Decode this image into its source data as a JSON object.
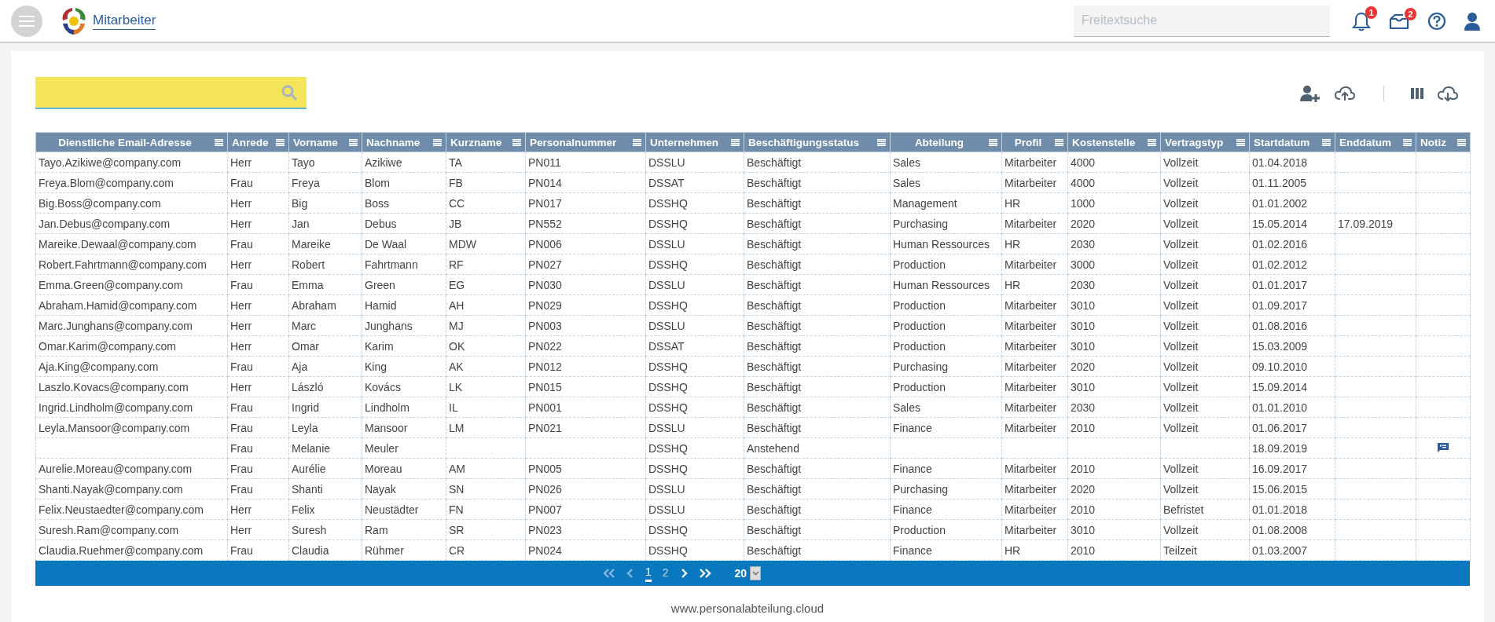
{
  "header": {
    "app_title": "Mitarbeiter",
    "search": {
      "placeholder": "Freitextsuche"
    },
    "notifications_badge": "1",
    "messages_badge": "2"
  },
  "table": {
    "columns": [
      {
        "label": "Dienstliche Email-Adresse"
      },
      {
        "label": "Anrede"
      },
      {
        "label": "Vorname"
      },
      {
        "label": "Nachname"
      },
      {
        "label": "Kurzname"
      },
      {
        "label": "Personalnummer"
      },
      {
        "label": "Unternehmen"
      },
      {
        "label": "Beschäftigungsstatus"
      },
      {
        "label": "Abteilung"
      },
      {
        "label": "Profil"
      },
      {
        "label": "Kostenstelle"
      },
      {
        "label": "Vertragstyp"
      },
      {
        "label": "Startdatum"
      },
      {
        "label": "Enddatum"
      },
      {
        "label": "Notiz"
      }
    ],
    "rows": [
      {
        "cells": [
          "Tayo.Azikiwe@company.com",
          "Herr",
          "Tayo",
          "Azikiwe",
          "TA",
          "PN011",
          "DSSLU",
          "Beschäftigt",
          "Sales",
          "Mitarbeiter",
          "4000",
          "Vollzeit",
          "01.04.2018",
          ""
        ],
        "has_note": false
      },
      {
        "cells": [
          "Freya.Blom@company.com",
          "Frau",
          "Freya",
          "Blom",
          "FB",
          "PN014",
          "DSSAT",
          "Beschäftigt",
          "Sales",
          "Mitarbeiter",
          "4000",
          "Vollzeit",
          "01.11.2005",
          ""
        ],
        "has_note": false
      },
      {
        "cells": [
          "Big.Boss@company.com",
          "Herr",
          "Big",
          "Boss",
          "CC",
          "PN017",
          "DSSHQ",
          "Beschäftigt",
          "Management",
          "HR",
          "1000",
          "Vollzeit",
          "01.01.2002",
          ""
        ],
        "has_note": false
      },
      {
        "cells": [
          "Jan.Debus@company.com",
          "Herr",
          "Jan",
          "Debus",
          "JB",
          "PN552",
          "DSSHQ",
          "Beschäftigt",
          "Purchasing",
          "Mitarbeiter",
          "2020",
          "Vollzeit",
          "15.05.2014",
          "17.09.2019"
        ],
        "has_note": false
      },
      {
        "cells": [
          "Mareike.Dewaal@company.com",
          "Frau",
          "Mareike",
          "De Waal",
          "MDW",
          "PN006",
          "DSSLU",
          "Beschäftigt",
          "Human Ressources",
          "HR",
          "2030",
          "Vollzeit",
          "01.02.2016",
          ""
        ],
        "has_note": false
      },
      {
        "cells": [
          "Robert.Fahrtmann@company.com",
          "Herr",
          "Robert",
          "Fahrtmann",
          "RF",
          "PN027",
          "DSSHQ",
          "Beschäftigt",
          "Production",
          "Mitarbeiter",
          "3000",
          "Vollzeit",
          "01.02.2012",
          ""
        ],
        "has_note": false
      },
      {
        "cells": [
          "Emma.Green@company.com",
          "Frau",
          "Emma",
          "Green",
          "EG",
          "PN030",
          "DSSLU",
          "Beschäftigt",
          "Human Ressources",
          "HR",
          "2030",
          "Vollzeit",
          "01.01.2017",
          ""
        ],
        "has_note": false
      },
      {
        "cells": [
          "Abraham.Hamid@company.com",
          "Herr",
          "Abraham",
          "Hamid",
          "AH",
          "PN029",
          "DSSHQ",
          "Beschäftigt",
          "Production",
          "Mitarbeiter",
          "3010",
          "Vollzeit",
          "01.09.2017",
          ""
        ],
        "has_note": false
      },
      {
        "cells": [
          "Marc.Junghans@company.com",
          "Herr",
          "Marc",
          "Junghans",
          "MJ",
          "PN003",
          "DSSLU",
          "Beschäftigt",
          "Production",
          "Mitarbeiter",
          "3010",
          "Vollzeit",
          "01.08.2016",
          ""
        ],
        "has_note": false
      },
      {
        "cells": [
          "Omar.Karim@company.com",
          "Herr",
          "Omar",
          "Karim",
          "OK",
          "PN022",
          "DSSAT",
          "Beschäftigt",
          "Production",
          "Mitarbeiter",
          "3010",
          "Vollzeit",
          "15.03.2009",
          ""
        ],
        "has_note": false
      },
      {
        "cells": [
          "Aja.King@company.com",
          "Frau",
          "Aja",
          "King",
          "AK",
          "PN012",
          "DSSHQ",
          "Beschäftigt",
          "Purchasing",
          "Mitarbeiter",
          "2020",
          "Vollzeit",
          "09.10.2010",
          ""
        ],
        "has_note": false
      },
      {
        "cells": [
          "Laszlo.Kovacs@company.com",
          "Herr",
          "László",
          "Kovács",
          "LK",
          "PN015",
          "DSSHQ",
          "Beschäftigt",
          "Production",
          "Mitarbeiter",
          "3010",
          "Vollzeit",
          "15.09.2014",
          ""
        ],
        "has_note": false
      },
      {
        "cells": [
          "Ingrid.Lindholm@company.com",
          "Frau",
          "Ingrid",
          "Lindholm",
          "IL",
          "PN001",
          "DSSHQ",
          "Beschäftigt",
          "Sales",
          "Mitarbeiter",
          "2030",
          "Vollzeit",
          "01.01.2010",
          ""
        ],
        "has_note": false
      },
      {
        "cells": [
          "Leyla.Mansoor@company.com",
          "Frau",
          "Leyla",
          "Mansoor",
          "LM",
          "PN021",
          "DSSLU",
          "Beschäftigt",
          "Finance",
          "Mitarbeiter",
          "2010",
          "Vollzeit",
          "01.06.2017",
          ""
        ],
        "has_note": false
      },
      {
        "cells": [
          "",
          "Frau",
          "Melanie",
          "Meuler",
          "",
          "",
          "DSSHQ",
          "Anstehend",
          "",
          "",
          "",
          "",
          "18.09.2019",
          ""
        ],
        "has_note": true
      },
      {
        "cells": [
          "Aurelie.Moreau@company.com",
          "Frau",
          "Aurélie",
          "Moreau",
          "AM",
          "PN005",
          "DSSHQ",
          "Beschäftigt",
          "Finance",
          "Mitarbeiter",
          "2010",
          "Vollzeit",
          "16.09.2017",
          ""
        ],
        "has_note": false
      },
      {
        "cells": [
          "Shanti.Nayak@company.com",
          "Frau",
          "Shanti",
          "Nayak",
          "SN",
          "PN026",
          "DSSLU",
          "Beschäftigt",
          "Purchasing",
          "Mitarbeiter",
          "2020",
          "Vollzeit",
          "15.06.2015",
          ""
        ],
        "has_note": false
      },
      {
        "cells": [
          "Felix.Neustaedter@company.com",
          "Herr",
          "Felix",
          "Neustädter",
          "FN",
          "PN007",
          "DSSLU",
          "Beschäftigt",
          "Finance",
          "Mitarbeiter",
          "2010",
          "Befristet",
          "01.01.2018",
          ""
        ],
        "has_note": false
      },
      {
        "cells": [
          "Suresh.Ram@company.com",
          "Herr",
          "Suresh",
          "Ram",
          "SR",
          "PN023",
          "DSSHQ",
          "Beschäftigt",
          "Production",
          "Mitarbeiter",
          "3010",
          "Vollzeit",
          "01.08.2008",
          ""
        ],
        "has_note": false
      },
      {
        "cells": [
          "Claudia.Ruehmer@company.com",
          "Frau",
          "Claudia",
          "Rühmer",
          "CR",
          "PN024",
          "DSSHQ",
          "Beschäftigt",
          "Finance",
          "HR",
          "2010",
          "Teilzeit",
          "01.03.2007",
          ""
        ],
        "has_note": false
      }
    ]
  },
  "pagination": {
    "pages": [
      {
        "label": "1",
        "selected": true
      },
      {
        "label": "2",
        "selected": false
      }
    ],
    "page_size": "20"
  },
  "footer": {
    "text": "www.personalabteilung.cloud"
  }
}
